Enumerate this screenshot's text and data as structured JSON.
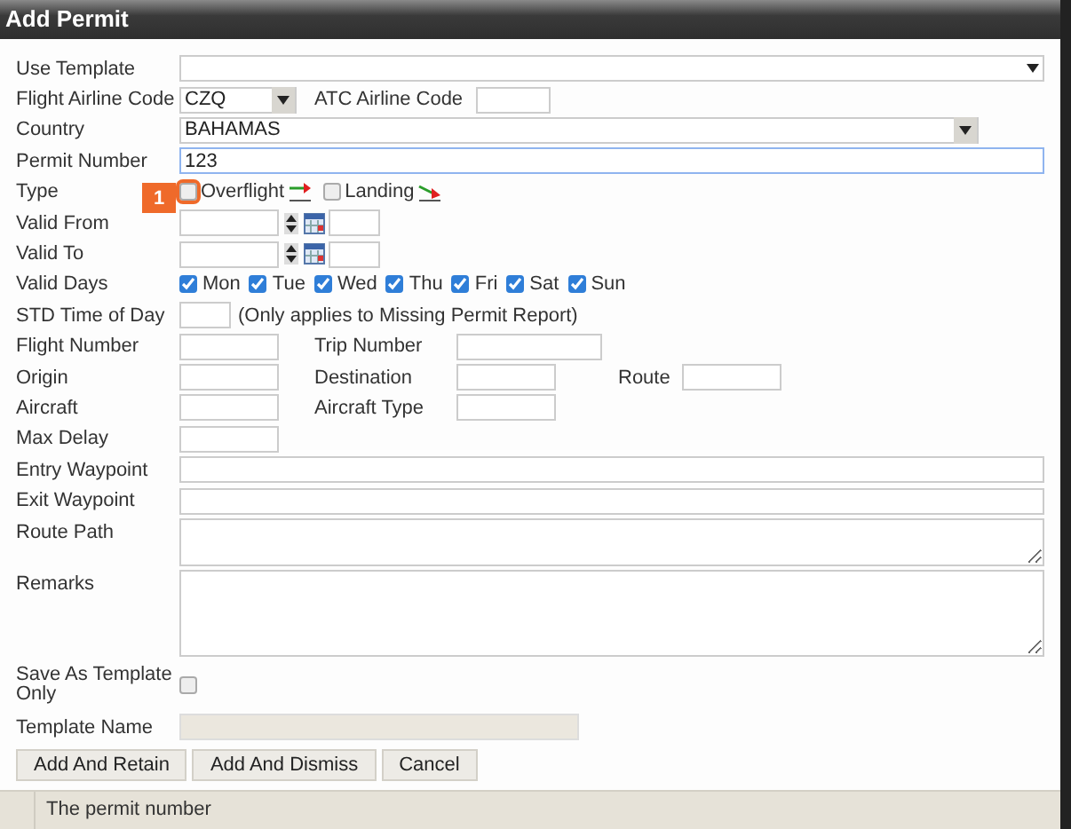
{
  "window": {
    "title": "Add Permit"
  },
  "use_template": {
    "label": "Use Template"
  },
  "airline_codes": {
    "flight_label": "Flight Airline Code",
    "flight_value": "CZQ",
    "atc_label": "ATC Airline Code"
  },
  "country": {
    "label": "Country",
    "value": "BAHAMAS"
  },
  "permit_number": {
    "label": "Permit Number",
    "value": "123",
    "focused": true
  },
  "type": {
    "label": "Type",
    "options": [
      {
        "label": "Overflight",
        "kind": "overflight",
        "checked": false,
        "highlighted": true
      },
      {
        "label": "Landing",
        "kind": "landing",
        "checked": false,
        "highlighted": false
      }
    ]
  },
  "step_badge": "1",
  "date_rows": [
    {
      "label": "Valid From"
    },
    {
      "label": "Valid To"
    }
  ],
  "valid_days": {
    "label": "Valid Days",
    "days": [
      {
        "label": "Mon",
        "checked": true
      },
      {
        "label": "Tue",
        "checked": true
      },
      {
        "label": "Wed",
        "checked": true
      },
      {
        "label": "Thu",
        "checked": true
      },
      {
        "label": "Fri",
        "checked": true
      },
      {
        "label": "Sat",
        "checked": true
      },
      {
        "label": "Sun",
        "checked": true
      }
    ]
  },
  "std_time": {
    "label": "STD Time of Day",
    "note": "(Only applies to Missing Permit Report)"
  },
  "small_field_rows": [
    [
      {
        "label": "Flight Number"
      },
      {
        "label": "Trip Number"
      }
    ],
    [
      {
        "label": "Origin"
      },
      {
        "label": "Destination"
      },
      {
        "label": "Route"
      }
    ],
    [
      {
        "label": "Aircraft"
      },
      {
        "label": "Aircraft Type"
      }
    ],
    [
      {
        "label": "Max Delay"
      }
    ]
  ],
  "wide_fields": [
    {
      "label": "Entry Waypoint",
      "kind": "line"
    },
    {
      "label": "Exit Waypoint",
      "kind": "line"
    },
    {
      "label": "Route Path",
      "kind": "area"
    },
    {
      "label": "Remarks",
      "kind": "area"
    }
  ],
  "save_as_template": {
    "label": "Save As Template Only",
    "checked": false
  },
  "template_name": {
    "label": "Template Name",
    "disabled": true
  },
  "buttons": [
    "Add And Retain",
    "Add And Dismiss",
    "Cancel"
  ],
  "status_bar": {
    "text": "The permit number"
  }
}
